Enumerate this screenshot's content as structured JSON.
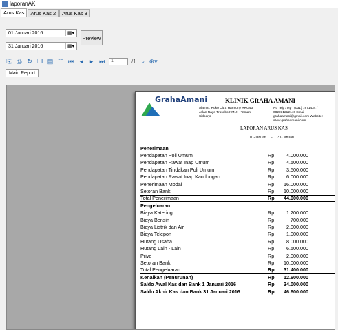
{
  "window": {
    "title": "laporanAK"
  },
  "tabs": [
    "Arus Kas",
    "Arus Kas 2",
    "Arus Kas 3"
  ],
  "filters": {
    "date_from": "01  Januari   2016",
    "date_to": "31  Januari   2016",
    "preview_label": "Preview"
  },
  "toolbar": {
    "page_value": "1",
    "page_total": "/1"
  },
  "report_tab": "Main Report",
  "report": {
    "logo_text": "GrahaAmani",
    "clinic_name": "KLINIK GRAHA AMANI",
    "address": "Alamat: Ruko Citra Harmony RKG43 Jalan Raya Trosobo KM19 - Taman Sidoarjo",
    "contact": "No Telp / Hp : (031) 7871434 / 082231212140 Email : grahaamani@gmail.com Website: www.grahaamani.com",
    "title": "LAPORAN ARUS KAS",
    "period_from": "01-Januari",
    "period_sep": "-",
    "period_to": "31-Januari",
    "rows": [
      {
        "label": "Penerimaan",
        "cur": "",
        "amount": "",
        "style": "bold"
      },
      {
        "label": "Pendapatan Poli Umum",
        "cur": "Rp",
        "amount": "4.000.000",
        "style": ""
      },
      {
        "label": "Pendapatan Rawat Inap Umum",
        "cur": "Rp",
        "amount": "4.500.000",
        "style": ""
      },
      {
        "label": "Pendapatan Tindakan Poli Umum",
        "cur": "Rp",
        "amount": "3.500.000",
        "style": ""
      },
      {
        "label": "Pendapatan Rawat Inap Kandungan",
        "cur": "Rp",
        "amount": "6.000.000",
        "style": ""
      },
      {
        "label": "Penerimaan Modal",
        "cur": "Rp",
        "amount": "16.000.000",
        "style": ""
      },
      {
        "label": "Setoran Bank",
        "cur": "Rp",
        "amount": "10.000.000",
        "style": ""
      },
      {
        "label": "Total Penerimaan",
        "cur": "Rp",
        "amount": "44.000.000",
        "style": "total"
      },
      {
        "label": "Pengeluaran",
        "cur": "",
        "amount": "",
        "style": "bold"
      },
      {
        "label": "Biaya Katering",
        "cur": "Rp",
        "amount": "1.200.000",
        "style": ""
      },
      {
        "label": "Biaya Bensin",
        "cur": "Rp",
        "amount": "700.000",
        "style": ""
      },
      {
        "label": "Biaya Listrik dan Air",
        "cur": "Rp",
        "amount": "2.000.000",
        "style": ""
      },
      {
        "label": "Biaya Telepon",
        "cur": "Rp",
        "amount": "1.000.000",
        "style": ""
      },
      {
        "label": "Hutang Usaha",
        "cur": "Rp",
        "amount": "8.000.000",
        "style": ""
      },
      {
        "label": "Hutang Lain - Lain",
        "cur": "Rp",
        "amount": "6.500.000",
        "style": ""
      },
      {
        "label": "Prive",
        "cur": "Rp",
        "amount": "2.000.000",
        "style": ""
      },
      {
        "label": "Setoran Bank",
        "cur": "Rp",
        "amount": "10.000.000",
        "style": ""
      },
      {
        "label": "Total Pengeluaran",
        "cur": "Rp",
        "amount": "31.400.000",
        "style": "total"
      },
      {
        "label": "Kenaikan (Penurunan)",
        "cur": "Rp",
        "amount": "12.600.000",
        "style": "bold"
      },
      {
        "label": "Saldo Awal Kas dan Bank 1 Januari 2016",
        "cur": "Rp",
        "amount": "34.000.000",
        "style": "bold"
      },
      {
        "label": "Saldo Akhir Kas dan Bank 31 Januari 2016",
        "cur": "Rp",
        "amount": "46.600.000",
        "style": "bold"
      }
    ]
  }
}
